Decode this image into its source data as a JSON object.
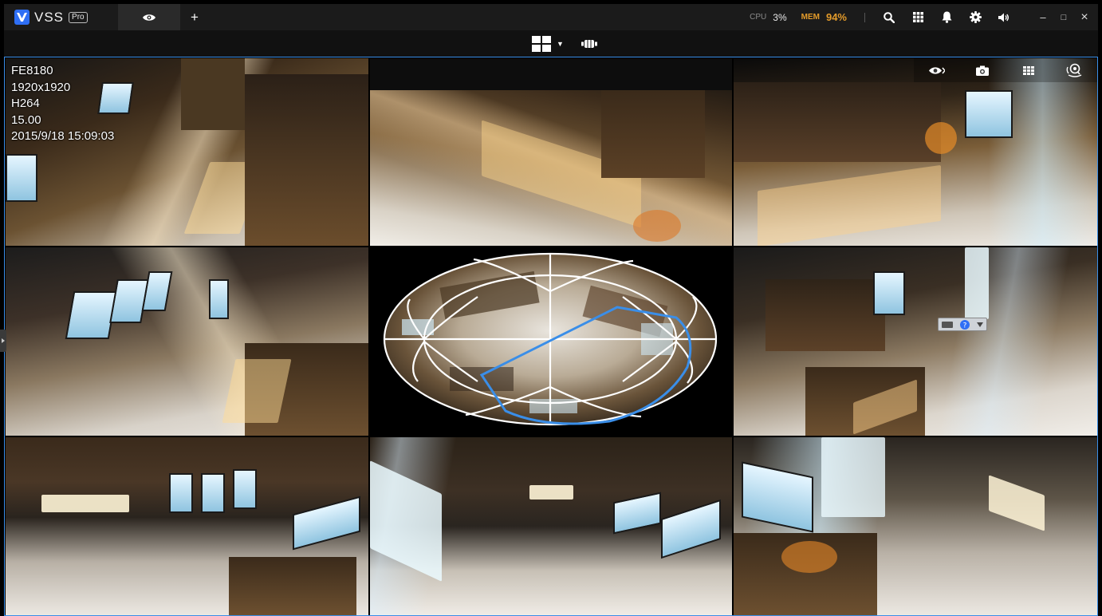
{
  "app": {
    "logo_text": "VSS",
    "badge": "Pro",
    "add_tab": "+"
  },
  "stats": {
    "cpu_label": "CPU",
    "cpu_value": "3%",
    "mem_label": "MEM",
    "mem_value": "94%"
  },
  "window": {
    "minimize": "–",
    "maximize": "□",
    "close": "×"
  },
  "layout": {
    "caret": "▼"
  },
  "camera_info": {
    "model": "FE8180",
    "resolution": "1920x1920",
    "codec": "H264",
    "fps": "15.00",
    "timestamp": "2015/9/18 15:09:03"
  },
  "cell_tools": [
    "eye-icon",
    "snapshot-icon",
    "layout-grid-icon",
    "fisheye-dewarp-icon"
  ],
  "colors": {
    "accent": "#3a8ee8",
    "logo": "#2f6ff5",
    "mem_warning": "#e39b2a",
    "titlebar": "#1b1b1b"
  }
}
